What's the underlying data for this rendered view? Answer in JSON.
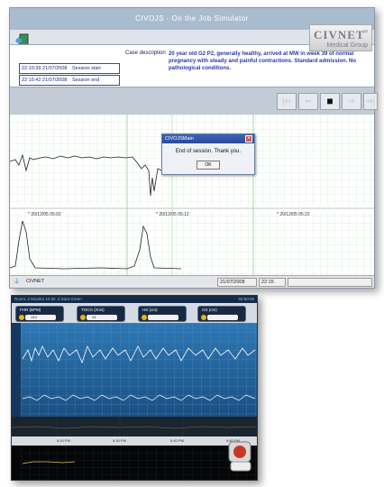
{
  "window1": {
    "title": "CIVOJS - On the Job Simulator",
    "logo": {
      "name": "CIVNET",
      "suffix": "us",
      "subtitle": "Medical Group"
    },
    "session_start": {
      "value": "22:10:39 21/07/2008",
      "label": "Session start"
    },
    "session_end": {
      "value": "22:15:42 21/07/2008",
      "label": "Session end"
    },
    "case_label": "Case description",
    "case_text": "20 year old G2 P2, generally healthy, arrived at MW in week 39 of normal pregnancy with steady and painful contractions. Standard admission. No pathological conditions.",
    "nav_buttons": [
      {
        "icon": "skip-back-icon",
        "glyph": "|⇐"
      },
      {
        "icon": "arrow-left-icon",
        "glyph": "⇐"
      },
      {
        "icon": "stop-icon",
        "glyph": "■"
      },
      {
        "icon": "arrow-right-icon",
        "glyph": "⇒"
      },
      {
        "icon": "skip-forward-icon",
        "glyph": "⇒|"
      }
    ],
    "time_marks": [
      "* 20/12/05 05:02",
      "* 20/12/05 05:12",
      "* 20/12/05 05:22"
    ],
    "status": {
      "app": "CIVNET",
      "date": "21/07/2008",
      "time": "22:15"
    },
    "dialog": {
      "title": "CIVOJSMain",
      "message": "End of session. Thank you.",
      "ok": "OK"
    }
  },
  "window2": {
    "top_left": "Room: 2   Monitor 10   ID: 2   Sara Green",
    "top_right": "02:50:05",
    "panels": [
      {
        "title": "FHR",
        "unit": "(BPM)",
        "value": "143"
      },
      {
        "title": "TOCO",
        "unit": "(/min)",
        "value": "43"
      },
      {
        "title": "HS",
        "unit": "(cm)",
        "value": ""
      },
      {
        "title": "CD",
        "unit": "(cm)",
        "value": ""
      }
    ],
    "axis_ticks": [
      "5:20 PM",
      "5:30 PM",
      "5:40 PM",
      "5:50 PM"
    ]
  },
  "colors": {
    "paper_grid": "#a8d9a8",
    "title_bar": "#a9bccf",
    "monitor_bg": "#2a6ea8",
    "trace_white": "#ffffff"
  }
}
